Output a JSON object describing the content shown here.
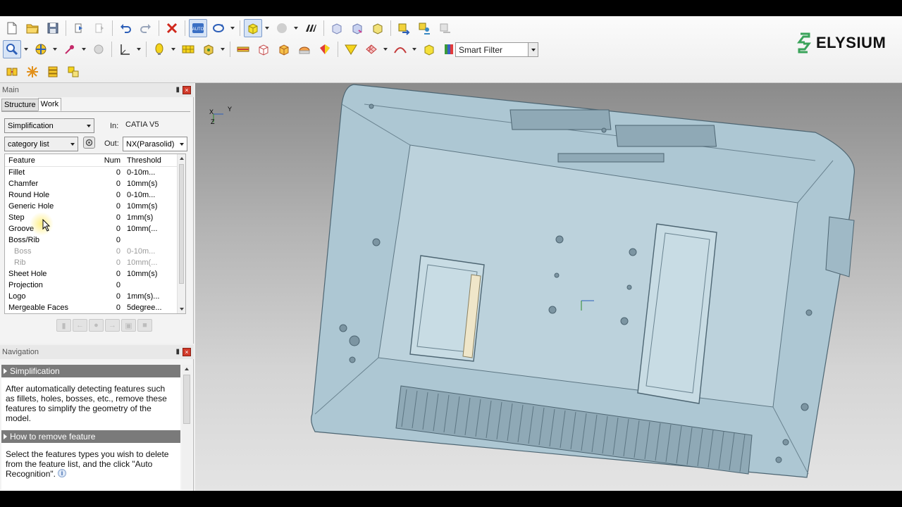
{
  "brand": {
    "name": "ELYSIUM"
  },
  "toolbar": {
    "row1": [
      "new-file-icon",
      "open-folder-icon",
      "save-icon",
      "import-icon",
      "export-icon",
      "undo-icon",
      "redo-icon",
      "delete-icon",
      "auto-mode-icon",
      "rotate-icon",
      "shaded-box-icon",
      "sphere-icon",
      "fit-all-icon",
      "view-front-icon",
      "view-back-icon",
      "view-iso-icon",
      "swap-icon",
      "assign-icon",
      "hide-icon"
    ],
    "row2": [
      "zoom-window-icon",
      "pan-icon",
      "pick-point-icon",
      "measure-icon",
      "axis-icon",
      "bulb-icon",
      "grid-icon",
      "box-cut-icon",
      "ruler-icon",
      "cube-wire-icon",
      "cube-shaded-icon",
      "section-icon",
      "color-faces-icon",
      "triangle-icon",
      "mesh-icon",
      "curve-icon",
      "cube-yellow-icon",
      "colorbar-icon"
    ],
    "row3": [
      "feature-icon",
      "star-icon",
      "stack-icon",
      "cube-group-icon"
    ],
    "smart_filter": "Smart Filter"
  },
  "main_panel": {
    "title": "Main",
    "tabs": [
      {
        "label": "Structure"
      },
      {
        "label": "Work"
      }
    ],
    "mode": "Simplification",
    "in_label": "In:",
    "in_value": "CATIA V5",
    "list_mode": "category list",
    "out_label": "Out:",
    "out_value": "NX(Parasolid)",
    "columns": {
      "feature": "Feature",
      "num": "Num",
      "threshold": "Threshold"
    },
    "rows": [
      {
        "feature": "Fillet",
        "num": "0",
        "threshold": "0-10m..."
      },
      {
        "feature": "Chamfer",
        "num": "0",
        "threshold": "10mm(s)"
      },
      {
        "feature": "Round Hole",
        "num": "0",
        "threshold": "0-10m..."
      },
      {
        "feature": "Generic Hole",
        "num": "0",
        "threshold": "10mm(s)"
      },
      {
        "feature": "Step",
        "num": "0",
        "threshold": "1mm(s)"
      },
      {
        "feature": "Groove",
        "num": "0",
        "threshold": "10mm(..."
      },
      {
        "feature": "Boss/Rib",
        "num": "0",
        "threshold": ""
      },
      {
        "feature": "Boss",
        "num": "0",
        "threshold": "0-10m..."
      },
      {
        "feature": "Rib",
        "num": "0",
        "threshold": "10mm(..."
      },
      {
        "feature": "Sheet Hole",
        "num": "0",
        "threshold": "10mm(s)"
      },
      {
        "feature": "Projection",
        "num": "0",
        "threshold": ""
      },
      {
        "feature": "Logo",
        "num": "0",
        "threshold": "1mm(s)..."
      },
      {
        "feature": "Mergeable Faces",
        "num": "0",
        "threshold": "5degree..."
      }
    ]
  },
  "navigation_panel": {
    "title": "Navigation",
    "sections": [
      {
        "title": "Simplification",
        "text": "After automatically detecting features such as fillets, holes, bosses, etc., remove these features to simplify the geometry of the model."
      },
      {
        "title": "How to remove feature",
        "text": "Select the features types you wish to delete from the feature list, and the click \"Auto Recognition\"."
      }
    ]
  },
  "viewport": {
    "axis_x": "X",
    "axis_y": "Y",
    "axis_z": "Z",
    "model_color": "#b4cdd8"
  }
}
